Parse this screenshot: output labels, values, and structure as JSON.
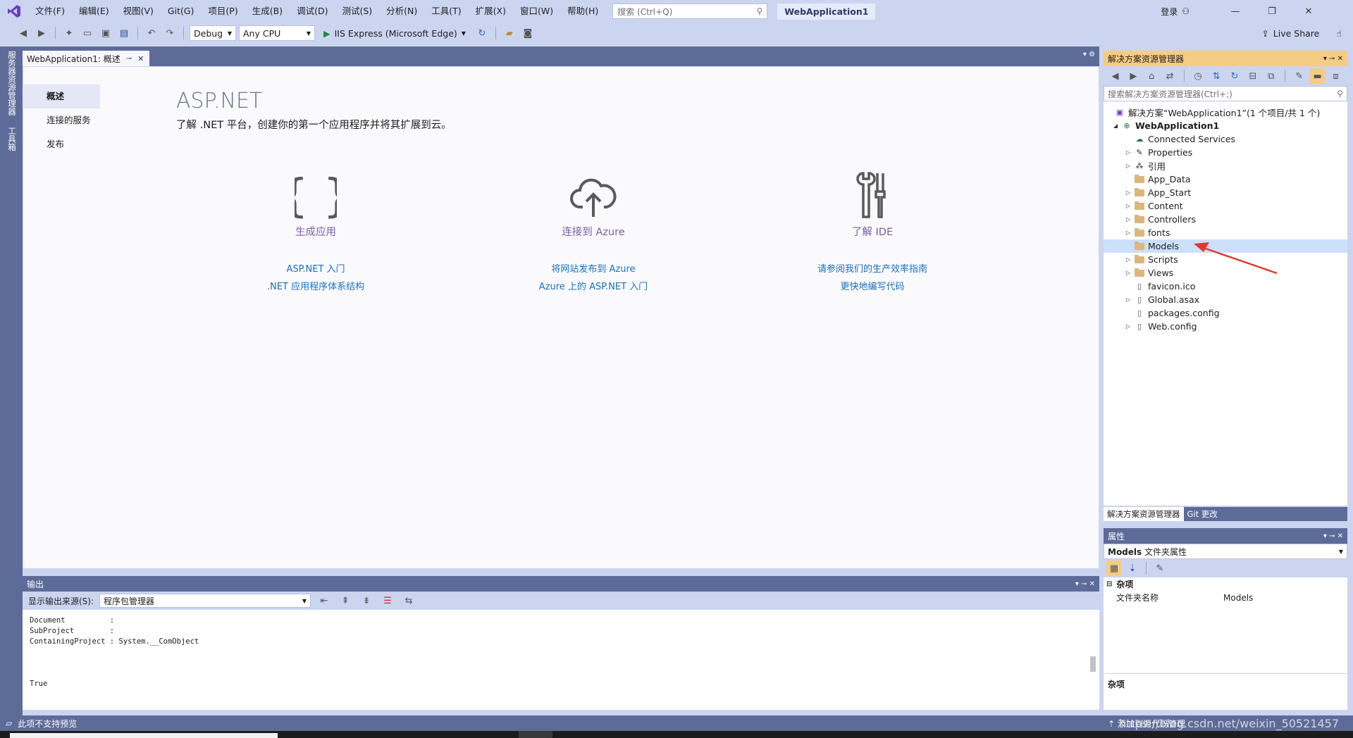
{
  "menubar": {
    "items": [
      "文件(F)",
      "编辑(E)",
      "视图(V)",
      "Git(G)",
      "项目(P)",
      "生成(B)",
      "调试(D)",
      "测试(S)",
      "分析(N)",
      "工具(T)",
      "扩展(X)",
      "窗口(W)",
      "帮助(H)"
    ],
    "search_placeholder": "搜索 (Ctrl+Q)",
    "solution_name": "WebApplication1",
    "login": "登录"
  },
  "toolbar": {
    "config": "Debug",
    "platform": "Any CPU",
    "run_target": "IIS Express (Microsoft Edge)",
    "live_share": "Live Share"
  },
  "sidestrip": {
    "server_explorer": "服务器资源管理器",
    "toolbox": "工具箱"
  },
  "doc_tab": {
    "title": "WebApplication1: 概述"
  },
  "overview": {
    "nav": [
      "概述",
      "连接的服务",
      "发布"
    ],
    "title": "ASP.NET",
    "subtitle": "了解 .NET 平台，创建你的第一个应用程序并将其扩展到云。",
    "features": [
      {
        "label": "生成应用",
        "links": [
          "ASP.NET 入门",
          ".NET 应用程序体系结构"
        ],
        "icon": "braces-icon"
      },
      {
        "label": "连接到 Azure",
        "links": [
          "将网站发布到 Azure",
          "Azure 上的 ASP.NET 入门"
        ],
        "icon": "cloud-upload-icon"
      },
      {
        "label": "了解 IDE",
        "links": [
          "请参阅我们的生产效率指南",
          "更快地编写代码"
        ],
        "icon": "tools-icon"
      }
    ]
  },
  "output": {
    "title": "输出",
    "source_label": "显示输出来源(S):",
    "source_value": "程序包管理器",
    "lines": [
      "Document          :",
      "SubProject        :",
      "ContainingProject : System.__ComObject",
      "",
      "",
      "",
      "True"
    ]
  },
  "solution_explorer": {
    "title": "解决方案资源管理器",
    "search_placeholder": "搜索解决方案资源管理器(Ctrl+;)",
    "solution_line": "解决方案“WebApplication1”(1 个项目/共 1 个)",
    "project": "WebApplication1",
    "items": [
      {
        "name": "Connected Services",
        "expander": ""
      },
      {
        "name": "Properties",
        "expander": "▷"
      },
      {
        "name": "引用",
        "expander": "▷"
      },
      {
        "name": "App_Data",
        "expander": ""
      },
      {
        "name": "App_Start",
        "expander": "▷"
      },
      {
        "name": "Content",
        "expander": "▷"
      },
      {
        "name": "Controllers",
        "expander": "▷"
      },
      {
        "name": "fonts",
        "expander": "▷"
      },
      {
        "name": "Models",
        "expander": ""
      },
      {
        "name": "Scripts",
        "expander": "▷"
      },
      {
        "name": "Views",
        "expander": "▷"
      },
      {
        "name": "favicon.ico",
        "expander": ""
      },
      {
        "name": "Global.asax",
        "expander": "▷"
      },
      {
        "name": "packages.config",
        "expander": ""
      },
      {
        "name": "Web.config",
        "expander": "▷"
      }
    ],
    "tabs": [
      "解决方案资源管理器",
      "Git 更改"
    ]
  },
  "properties": {
    "title": "属性",
    "object": "Models",
    "object_type": "文件夹属性",
    "category": "杂项",
    "rows": [
      {
        "name": "文件夹名称",
        "value": "Models"
      }
    ],
    "description_title": "杂项"
  },
  "statusbar": {
    "text": "此项不支持预览",
    "right_text": "添加到源代码管理"
  },
  "watermark": "https://blog.csdn.net/weixin_50521457",
  "colors": {
    "accent": "#5d6b99",
    "selection": "#cce0fb",
    "link": "#1a6fc0",
    "feature_label": "#7a5ca8",
    "arrow": "#e03a2f"
  }
}
